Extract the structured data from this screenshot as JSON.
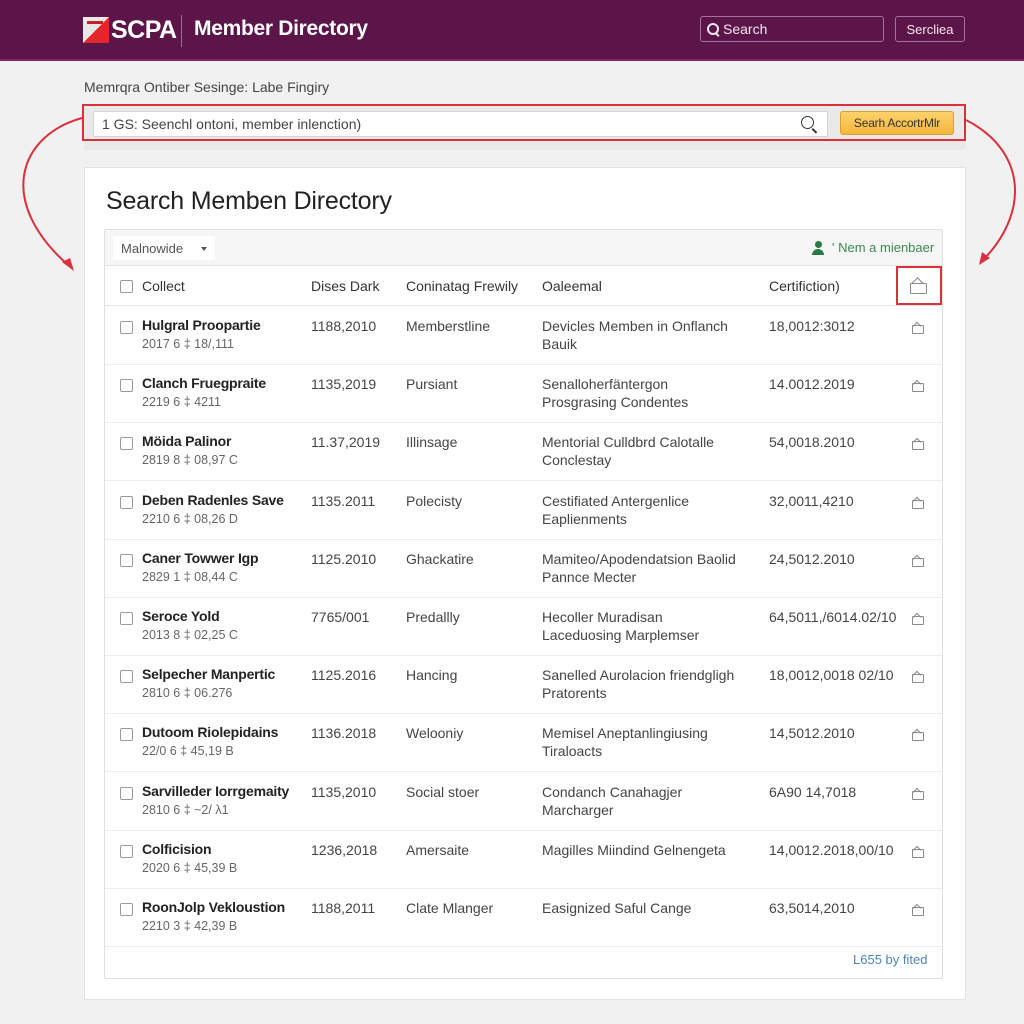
{
  "header": {
    "logo_text": "SCPA",
    "app_title": "Member Directory",
    "search_placeholder": "Search",
    "search_button": "Sercliea"
  },
  "breadcrumb": "Memrqra Ontiber Sesinge: Labe Fingiry",
  "search_bar": {
    "placeholder": "1 GS: Seenchl ontoni, member inlenction)",
    "button_label": "Searh AccortrMlr",
    "button_color": "#f4b73c"
  },
  "panel": {
    "title": "Search Memben Directory",
    "filter_select": "Malnowide",
    "new_member_label": "' Nem a mienbaer",
    "footer_count": "L655 by fited"
  },
  "table": {
    "columns": [
      "Collect",
      "Dises Dark",
      "Coninatag Frewily",
      "Oaleemal",
      "Certifiction)"
    ],
    "rows": [
      {
        "name": "Hulgral Proopartie",
        "sub": "2017 6 ‡ 18/,111",
        "date": "1188,2010",
        "category": "Memberstline",
        "description": "Devicles Memben in Onflanch Bauik",
        "cert": "18,0012:3012"
      },
      {
        "name": "Clanch Fruegpraite",
        "sub": "2219 6 ‡ 4211",
        "date": "1135,2019",
        "category": "Pursiant",
        "description": "Senalloherfäntergon Prosgrasing Condentes",
        "cert": "14.0012.2019"
      },
      {
        "name": "Möida Palinor",
        "sub": "2819 8 ‡ 08,97 C",
        "date": "11.37,2019",
        "category": "Illinsage",
        "description": "Mentorial Culldbrd Calotalle Conclestay",
        "cert": "54,0018.2010"
      },
      {
        "name": "Deben Radenles Save",
        "sub": "2210 6 ‡ 08,26 D",
        "date": "1135.2011",
        "category": "Polecisty",
        "description": "Cestifiated Antergenlice Eaplienments",
        "cert": "32,0011,4210"
      },
      {
        "name": "Caner Towwer Igp",
        "sub": "2829 1 ‡ 08,44 C",
        "date": "1125.2010",
        "category": "Ghackatire",
        "description": "Mamiteo/Apodendatsion Baolid Pannce Mecter",
        "cert": "24,5012.2010"
      },
      {
        "name": "Seroce Yold",
        "sub": "2013 8 ‡ 02,25 C",
        "date": "7765/001",
        "category": "Predallly",
        "description": "Hecoller Muradisan Laceduosing Marplemser",
        "cert": "64,5011,/6014.02/10"
      },
      {
        "name": "Selpecher Manpertic",
        "sub": "2810 6 ‡ 06.276",
        "date": "1125.2016",
        "category": "Hancing",
        "description": "Sanelled Aurolacion friendgligh Pratorents",
        "cert": "18,0012,0018 02/10"
      },
      {
        "name": "Dutoom Riolepidains",
        "sub": "22/0 6 ‡ 45,19 B",
        "date": "1136.2018",
        "category": "Welooniy",
        "description": "Memisel Aneptanlingiusing Tiraloacts",
        "cert": "14,5012.2010"
      },
      {
        "name": "Sarvilleder Iorrgemaity",
        "sub": "2810 6 ‡ ~2/ λ1",
        "date": "1135,2010",
        "category": "Social stoer",
        "description": "Condanch Canahagjer Marcharger",
        "cert": "6A90 14,7018"
      },
      {
        "name": "Colficision",
        "sub": "2020 6 ‡ 45,39 B",
        "date": "1236,2018",
        "category": "Amersaite",
        "description": "Magilles Miindind Gelnengeta",
        "cert": "14,0012.2018,00/10"
      },
      {
        "name": "RoonJolp Vekloustion",
        "sub": "2210 3 ‡ 42,39 B",
        "date": "1188,2011",
        "category": "Clate Mlanger",
        "description": "Easignized Saful Cange",
        "cert": "63,5014,2010"
      }
    ]
  },
  "colors": {
    "brand": "#5c1548",
    "highlight": "#d9303b",
    "accent": "#f4b73c",
    "link": "#4a86b8",
    "success": "#2a7a45"
  }
}
